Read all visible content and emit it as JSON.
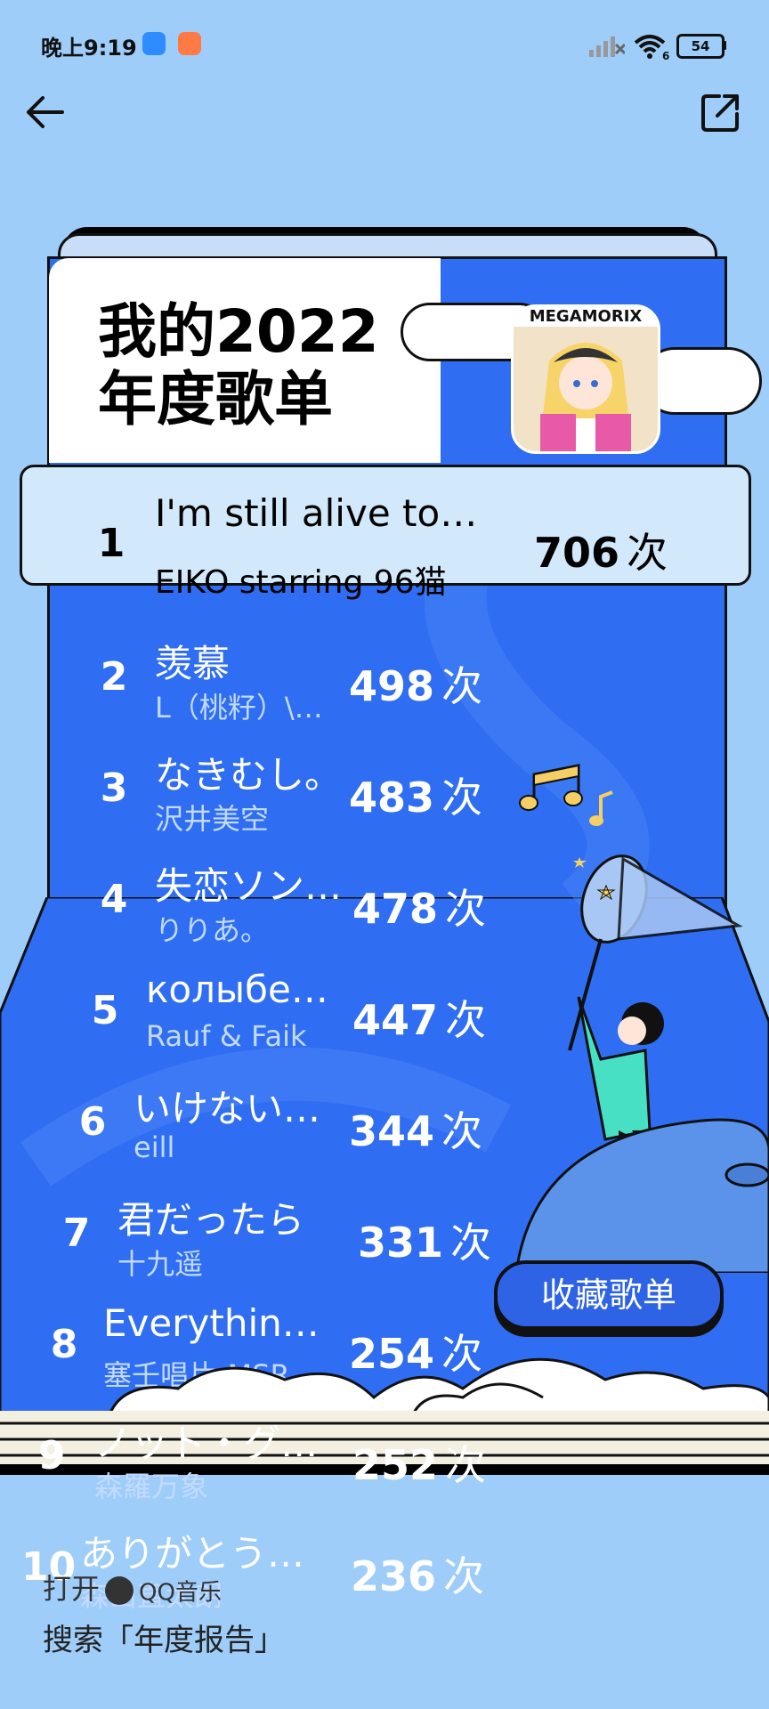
{
  "status_bar": {
    "time": "晚上9:19",
    "battery": "54",
    "wifi_label": "6"
  },
  "header": {
    "title_line1": "我的2022",
    "title_line2": "年度歌单",
    "cover_text": "MEGAMORIX"
  },
  "playlist": [
    {
      "rank": "1",
      "song": "I'm still alive to…",
      "artist": "EIKO starring 96猫",
      "count": "706",
      "unit": "次"
    },
    {
      "rank": "2",
      "song": "羡慕",
      "artist": "L（桃籽）\\…",
      "count": "498",
      "unit": "次"
    },
    {
      "rank": "3",
      "song": "なきむし。",
      "artist": "沢井美空",
      "count": "483",
      "unit": "次"
    },
    {
      "rank": "4",
      "song": "失恋ソン…",
      "artist": "りりあ。",
      "count": "478",
      "unit": "次"
    },
    {
      "rank": "5",
      "song": "колыбел…",
      "artist": "Rauf & Faik",
      "count": "447",
      "unit": "次"
    },
    {
      "rank": "6",
      "song": "いけないb…",
      "artist": "eill",
      "count": "344",
      "unit": "次"
    },
    {
      "rank": "7",
      "song": "君だったら",
      "artist": "十九遥",
      "count": "331",
      "unit": "次"
    },
    {
      "rank": "8",
      "song": "Everything'…",
      "artist": "塞壬唱片-MSR…",
      "count": "254",
      "unit": "次"
    },
    {
      "rank": "9",
      "song": "ノット・グ…",
      "artist": "森羅万象",
      "count": "252",
      "unit": "次"
    },
    {
      "rank": "10",
      "song": "ありがとうは…",
      "artist": "森山直太朗",
      "count": "236",
      "unit": "次"
    }
  ],
  "actions": {
    "collect": "收藏歌单"
  },
  "footer": {
    "open": "打开",
    "app_name": "QQ音乐",
    "search": "搜索「年度报告」"
  },
  "colors": {
    "background": "#9ecdfa",
    "page_blue": "#2f6ef2",
    "button_blue": "#2e63e6"
  }
}
